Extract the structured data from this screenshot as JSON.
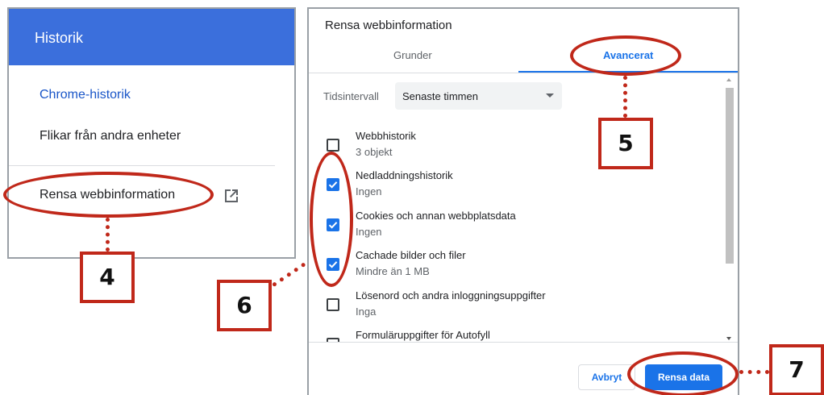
{
  "history_panel": {
    "header_title": "Historik",
    "items": [
      {
        "label": "Chrome-historik"
      },
      {
        "label": "Flikar från andra enheter"
      },
      {
        "label": "Rensa webbinformation"
      }
    ]
  },
  "dialog": {
    "title": "Rensa webbinformation",
    "tabs": [
      {
        "label": "Grunder",
        "active": false
      },
      {
        "label": "Avancerat",
        "active": true
      }
    ],
    "time_range": {
      "label": "Tidsintervall",
      "selected": "Senaste timmen"
    },
    "options": [
      {
        "title": "Webbhistorik",
        "subtitle": "3 objekt",
        "checked": false
      },
      {
        "title": "Nedladdningshistorik",
        "subtitle": "Ingen",
        "checked": true
      },
      {
        "title": "Cookies och annan webbplatsdata",
        "subtitle": "Ingen",
        "checked": true
      },
      {
        "title": "Cachade bilder och filer",
        "subtitle": "Mindre än 1 MB",
        "checked": true
      },
      {
        "title": "Lösenord och andra inloggningsuppgifter",
        "subtitle": "Inga",
        "checked": false
      },
      {
        "title": "Formuläruppgifter för Autofyll",
        "subtitle": "",
        "checked": false
      }
    ],
    "buttons": {
      "cancel": "Avbryt",
      "clear": "Rensa data"
    }
  },
  "annotations": {
    "step_4": "4",
    "step_5": "5",
    "step_6": "6",
    "step_7": "7"
  },
  "colors": {
    "header_blue": "#3b6fdc",
    "accent_blue": "#1a73e8",
    "annotation_red": "#c0281a"
  }
}
